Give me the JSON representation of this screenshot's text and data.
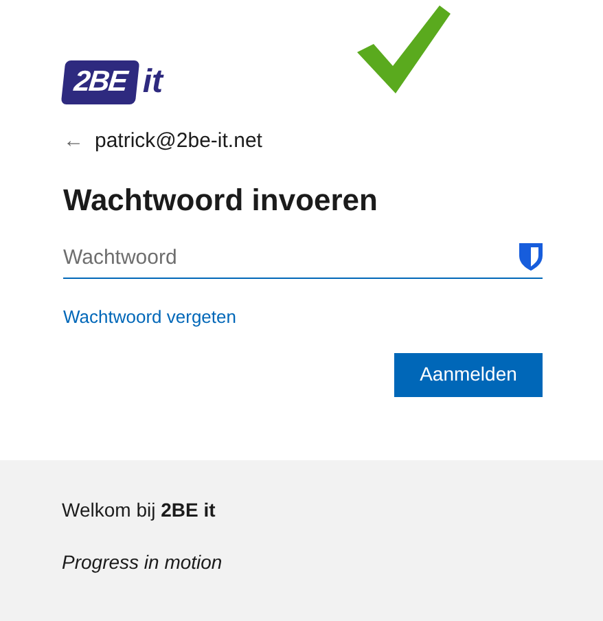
{
  "logo": {
    "badge": "2BE",
    "suffix": "it"
  },
  "back_arrow": "←",
  "account": "patrick@2be-it.net",
  "heading": "Wachtwoord invoeren",
  "password_field": {
    "placeholder": "Wachtwoord"
  },
  "forgot_link": "Wachtwoord vergeten",
  "buttons": [
    "Aanmelden"
  ],
  "footer": {
    "welcome": "Welkom bij **2BE it**",
    "tagline": "Progress in motion"
  }
}
